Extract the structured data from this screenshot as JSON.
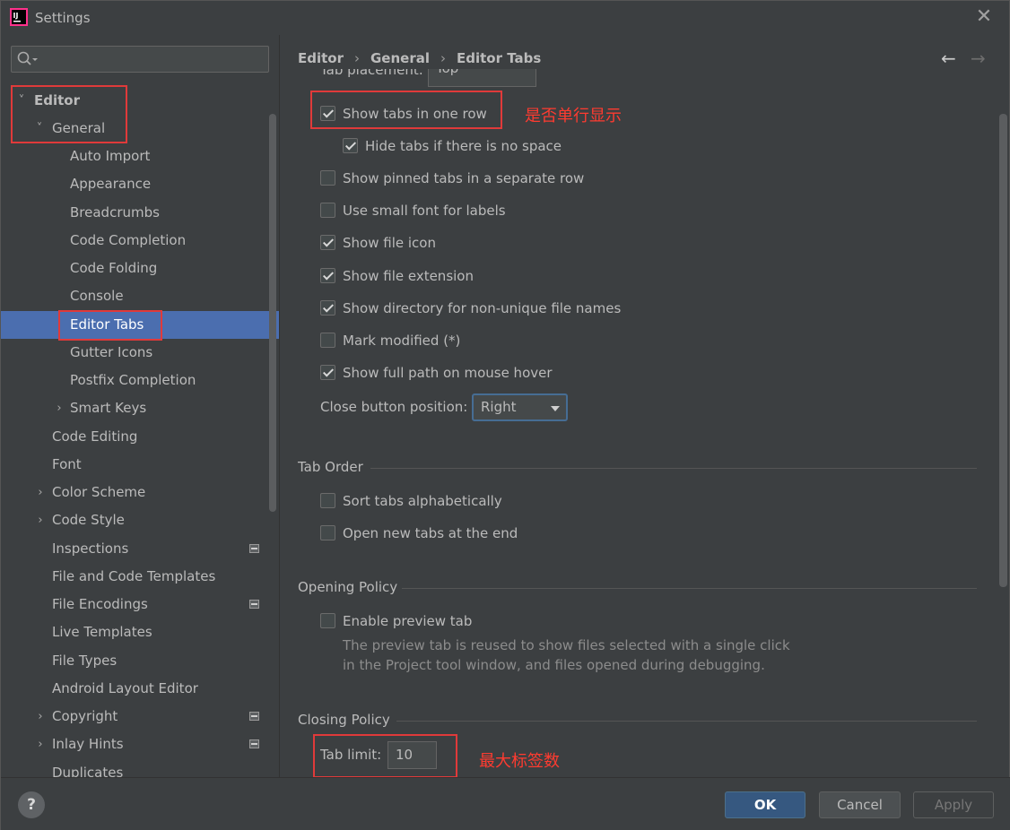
{
  "window": {
    "title": "Settings",
    "close_glyph": "✕"
  },
  "sidebar": {
    "search": {
      "value": "",
      "placeholder": ""
    },
    "items": [
      {
        "label": "Editor",
        "arrow": "˅"
      },
      {
        "label": "General",
        "arrow": "˅"
      },
      {
        "label": "Auto Import"
      },
      {
        "label": "Appearance"
      },
      {
        "label": "Breadcrumbs"
      },
      {
        "label": "Code Completion"
      },
      {
        "label": "Code Folding"
      },
      {
        "label": "Console"
      },
      {
        "label": "Editor Tabs"
      },
      {
        "label": "Gutter Icons"
      },
      {
        "label": "Postfix Completion"
      },
      {
        "label": "Smart Keys",
        "arrow": "›"
      },
      {
        "label": "Code Editing"
      },
      {
        "label": "Font"
      },
      {
        "label": "Color Scheme",
        "arrow": "›"
      },
      {
        "label": "Code Style",
        "arrow": "›"
      },
      {
        "label": "Inspections"
      },
      {
        "label": "File and Code Templates"
      },
      {
        "label": "File Encodings"
      },
      {
        "label": "Live Templates"
      },
      {
        "label": "File Types"
      },
      {
        "label": "Android Layout Editor"
      },
      {
        "label": "Copyright",
        "arrow": "›"
      },
      {
        "label": "Inlay Hints",
        "arrow": "›"
      },
      {
        "label": "Duplicates"
      }
    ]
  },
  "breadcrumb": {
    "items": [
      "Editor",
      "General",
      "Editor Tabs"
    ],
    "separator": "›",
    "back": "←",
    "forward": "→"
  },
  "content": {
    "cut_label": "Tab placement:",
    "cut_value": "Top",
    "options": [
      {
        "label": "Show tabs in one row",
        "checked": true
      },
      {
        "label": "Hide tabs if there is no space",
        "checked": true
      },
      {
        "label": "Show pinned tabs in a separate row",
        "checked": false
      },
      {
        "label": "Use small font for labels",
        "checked": false
      },
      {
        "label": "Show file icon",
        "checked": true
      },
      {
        "label": "Show file extension",
        "checked": true
      },
      {
        "label": "Show directory for non-unique file names",
        "checked": true
      },
      {
        "label": "Mark modified (*)",
        "checked": false
      },
      {
        "label": "Show full path on mouse hover",
        "checked": true
      }
    ],
    "close_button": {
      "label": "Close button position:",
      "value": "Right"
    },
    "tab_order": {
      "title": "Tab Order",
      "options": [
        {
          "label": "Sort tabs alphabetically",
          "checked": false
        },
        {
          "label": "Open new tabs at the end",
          "checked": false
        }
      ]
    },
    "opening_policy": {
      "title": "Opening Policy",
      "option": {
        "label": "Enable preview tab",
        "checked": false
      },
      "help_line1": "The preview tab is reused to show files selected with a single click",
      "help_line2": "in the Project tool window, and files opened during debugging."
    },
    "closing_policy": {
      "title": "Closing Policy",
      "tab_limit_label": "Tab limit:",
      "tab_limit_value": "10"
    }
  },
  "annotations": {
    "single_row": "是否单行显示",
    "max_tabs": "最大标签数"
  },
  "footer": {
    "help": "?",
    "ok": "OK",
    "cancel": "Cancel",
    "apply": "Apply"
  }
}
